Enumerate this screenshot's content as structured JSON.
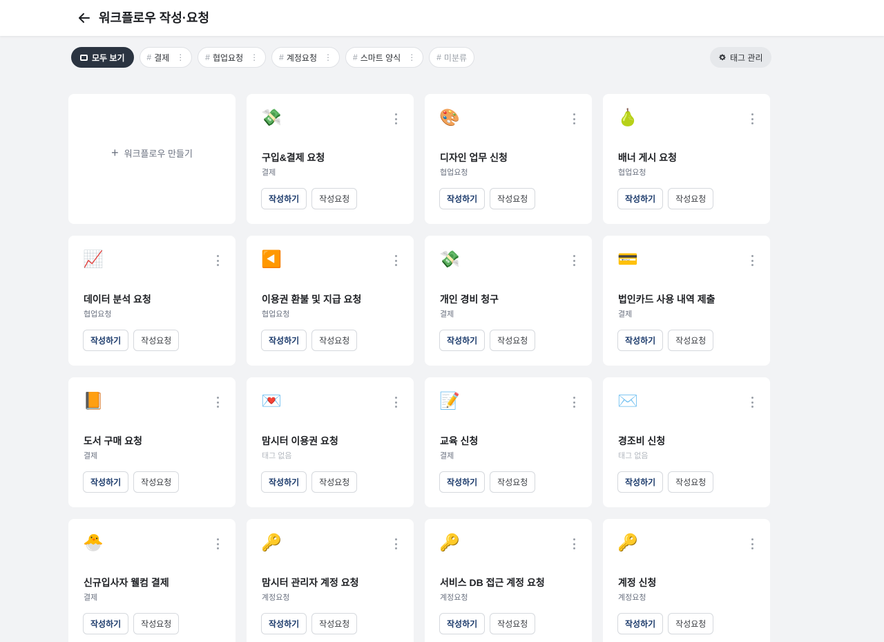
{
  "header": {
    "title": "워크플로우 작성·요청",
    "back_icon": "arrow-left-icon"
  },
  "tags": {
    "all_label": "모두 보기",
    "items": [
      {
        "label": "결제"
      },
      {
        "label": "협업요청"
      },
      {
        "label": "계정요청"
      },
      {
        "label": "스마트 양식"
      }
    ],
    "uncategorized": "미분류",
    "manage_label": "태그 관리"
  },
  "create_label": "워크플로우 만들기",
  "buttons": {
    "write": "작성하기",
    "requested": "작성요청"
  },
  "cards": [
    {
      "emoji": "💸",
      "title": "구입&결제 요청",
      "tag": "결제"
    },
    {
      "emoji": "🎨",
      "title": "디자인 업무 신청",
      "tag": "협업요청"
    },
    {
      "emoji": "🍐",
      "title": "배너 게시 요청",
      "tag": "협업요청"
    },
    {
      "emoji": "📈",
      "title": "데이터 분석 요청",
      "tag": "협업요청"
    },
    {
      "emoji": "◀️",
      "title": "이용권 환불 및 지급 요청",
      "tag": "협업요청"
    },
    {
      "emoji": "💸",
      "title": "개인 경비 청구",
      "tag": "결제"
    },
    {
      "emoji": "💳",
      "title": "법인카드 사용 내역 제출",
      "tag": "결제"
    },
    {
      "emoji": "📙",
      "title": "도서 구매 요청",
      "tag": "결제"
    },
    {
      "emoji": "💌",
      "title": "맘시터 이용권 요청",
      "tag": "태그 없음"
    },
    {
      "emoji": "📝",
      "title": "교육 신청",
      "tag": "결제"
    },
    {
      "emoji": "✉️",
      "title": "경조비 신청",
      "tag": "태그 없음"
    },
    {
      "emoji": "🐣",
      "title": "신규입사자 웰컴 결제",
      "tag": "결제"
    },
    {
      "emoji": "🔑",
      "title": "맘시터 관리자 계정 요청",
      "tag": "계정요청"
    },
    {
      "emoji": "🔑",
      "title": "서비스 DB 접근 계정 요청",
      "tag": "계정요청"
    },
    {
      "emoji": "🔑",
      "title": "계정 신청",
      "tag": "계정요청"
    }
  ]
}
